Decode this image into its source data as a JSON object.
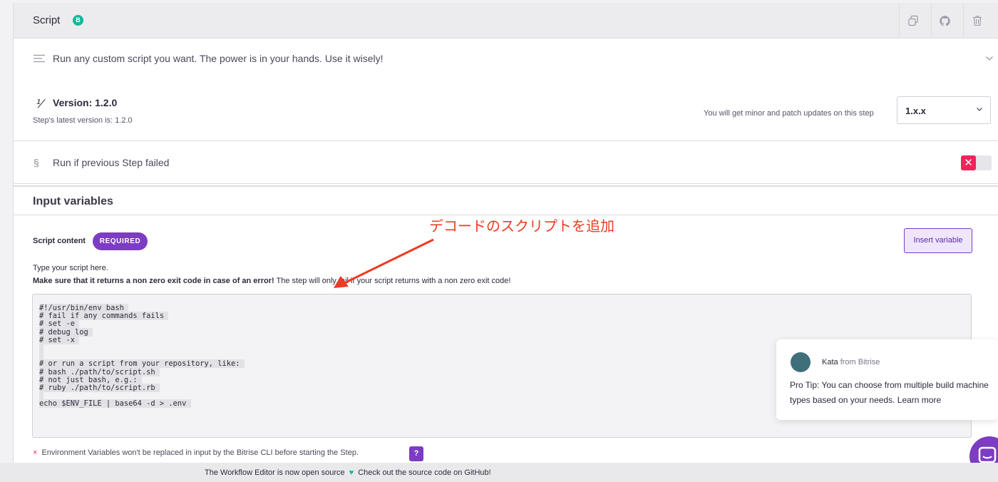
{
  "header": {
    "title": "Script",
    "badge": "B"
  },
  "description": "Run any custom script you want. The power is in your hands. Use it wisely!",
  "version": {
    "title": "Version: 1.2.0",
    "latest": "Step's latest version is: 1.2.0",
    "update_hint": "You will get minor and patch updates on this step",
    "selected": "1.x.x"
  },
  "run_if": {
    "label": "Run if previous Step failed",
    "toggle_glyph": "✕"
  },
  "input_variables": {
    "title": "Input variables",
    "field_label": "Script content",
    "required_badge": "REQUIRED",
    "insert_variable": "Insert variable",
    "help_1": "Type your script here.",
    "help_2_bold": "Make sure that it returns a non zero exit code in case of an error!",
    "help_2_rest": " The step will only fail if your script returns with a non zero exit code!",
    "script_lines": [
      "#!/usr/bin/env bash",
      "# fail if any commands fails",
      "# set -e",
      "# debug log",
      "# set -x",
      "",
      "",
      "# or run a script from your repository, like:",
      "# bash ./path/to/script.sh",
      "# not just bash, e.g.:",
      "# ruby ./path/to/script.rb",
      "",
      "echo $ENV_FILE | base64 -d > .env"
    ],
    "env_note": "Environment Variables won't be replaced in input by the Bitrise CLI before starting the Step.",
    "help_button": "?"
  },
  "annotation": "デコードのスクリプトを追加",
  "chat": {
    "sender": "Kata",
    "sender_suffix": " from Bitrise",
    "message": "Pro Tip: You can choose from multiple build machine types based on your needs. Learn more"
  },
  "footer": {
    "text_1": "The Workflow Editor is now open source",
    "text_2": "Check out the source code on GitHub!"
  },
  "colors": {
    "accent": "#7d3cc4",
    "annotation": "#ee3a22",
    "toggle_off": "#f0245a",
    "badge": "#11b89b"
  }
}
